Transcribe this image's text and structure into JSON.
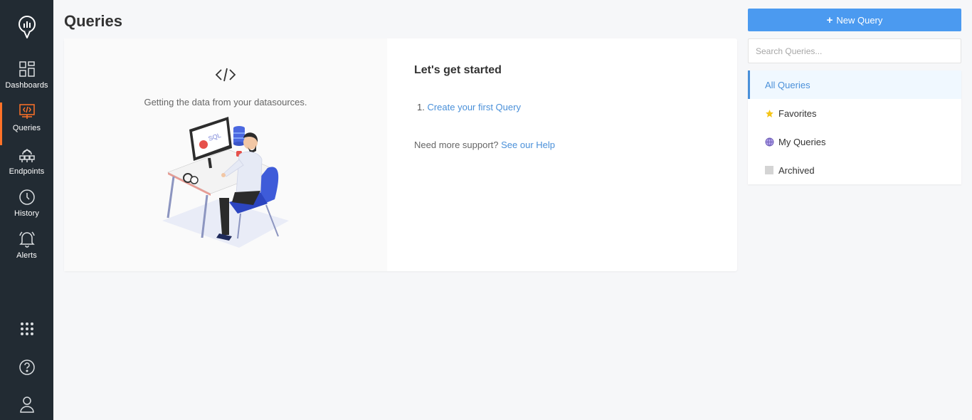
{
  "page": {
    "title": "Queries"
  },
  "sidebar": {
    "items": [
      {
        "label": "Dashboards",
        "icon": "dashboards-icon"
      },
      {
        "label": "Queries",
        "icon": "queries-icon",
        "active": true
      },
      {
        "label": "Endpoints",
        "icon": "endpoints-icon"
      },
      {
        "label": "History",
        "icon": "history-icon"
      },
      {
        "label": "Alerts",
        "icon": "alerts-icon"
      }
    ],
    "bottom_icons": [
      "apps-grid-icon",
      "help-icon",
      "user-icon"
    ],
    "active_color": "#ff7228",
    "background": "#222b33"
  },
  "empty_state": {
    "description": "Getting the data from your datasources.",
    "illustration_label": "SQL",
    "heading": "Let's get started",
    "step_number": "1.",
    "step_link": "Create your first Query",
    "help_prefix": "Need more support?",
    "help_link": "See our Help"
  },
  "right_panel": {
    "new_query_label": "New Query",
    "search_placeholder": "Search Queries...",
    "filters": [
      {
        "label": "All Queries",
        "active": true
      },
      {
        "label": "Favorites",
        "icon": "star-icon"
      },
      {
        "label": "My Queries",
        "icon": "globe-icon"
      },
      {
        "label": "Archived",
        "icon": "archive-icon"
      }
    ],
    "accent_color": "#4b9af0"
  }
}
